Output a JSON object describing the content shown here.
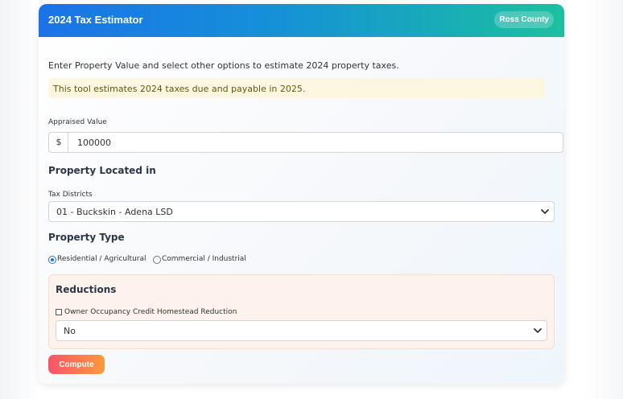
{
  "header": {
    "title": "2024 Tax Estimator",
    "county_badge": "Ross County"
  },
  "intro_text": "Enter Property Value and select other options to estimate 2024 property taxes.",
  "notice_text": "This tool estimates 2024 taxes due and payable in 2025.",
  "appraised": {
    "label": "Appraised Value",
    "prefix": "$",
    "value": "100000"
  },
  "location": {
    "section_title": "Property Located in",
    "districts_label": "Tax Districts",
    "selected_district": "01 - Buckskin - Adena LSD"
  },
  "property_type": {
    "section_title": "Property Type",
    "options": [
      {
        "label": "Residential / Agricultural",
        "checked": true
      },
      {
        "label": "Commercial / Industrial",
        "checked": false
      }
    ]
  },
  "reductions": {
    "section_title": "Reductions",
    "owner_occupancy_label": "Owner Occupancy Credit Homestead Reduction",
    "owner_occupancy_checked": false,
    "selected_option": "No"
  },
  "compute_label": "Compute",
  "colors": {
    "header_start": "#1a73e8",
    "header_end": "#1cc0a0",
    "button_start": "#f7546b",
    "button_end": "#fb9a3c",
    "notice_bg": "#fdf7e2",
    "reductions_bg": "#fdf3ec"
  },
  "icons": {
    "select_chevron": "chevron-down-icon",
    "radio": "radio-icon",
    "checkbox": "checkbox-icon"
  }
}
